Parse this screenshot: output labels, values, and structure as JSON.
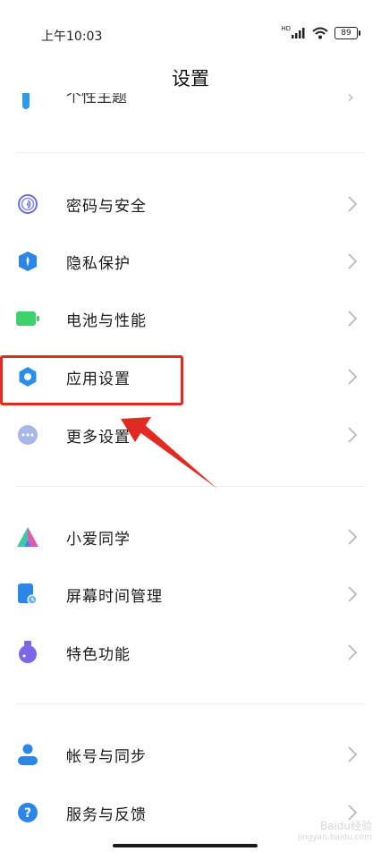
{
  "status_bar": {
    "time": "上午10:03",
    "signal_tag": "HD",
    "battery_level": "89"
  },
  "header": {
    "title": "设置"
  },
  "partial_item": {
    "label": "个性主题"
  },
  "groups": [
    {
      "items": [
        {
          "label": "密码与安全",
          "icon": "fingerprint-icon",
          "color": "#6b6fe0"
        },
        {
          "label": "隐私保护",
          "icon": "shield-icon",
          "color": "#2b86e8"
        },
        {
          "label": "电池与性能",
          "icon": "battery-icon",
          "color": "#3fd16b"
        },
        {
          "label": "应用设置",
          "icon": "gear-icon",
          "color": "#2a8ee8"
        },
        {
          "label": "更多设置",
          "icon": "more-dots-icon",
          "color": "#a8b6e8"
        }
      ]
    },
    {
      "items": [
        {
          "label": "小爱同学",
          "icon": "xiaoai-icon",
          "color": "#3ec9a6"
        },
        {
          "label": "屏幕时间管理",
          "icon": "screen-time-icon",
          "color": "#2b86e8"
        },
        {
          "label": "特色功能",
          "icon": "flask-icon",
          "color": "#7b68e8"
        }
      ]
    },
    {
      "items": [
        {
          "label": "帐号与同步",
          "icon": "user-icon",
          "color": "#2b86e8"
        },
        {
          "label": "服务与反馈",
          "icon": "help-icon",
          "color": "#2b86e8"
        }
      ]
    }
  ],
  "annotation": {
    "highlight_color": "#e02a22"
  },
  "watermark": {
    "line1": "Baidu经验",
    "line2": "jingyan.baidu.com"
  }
}
